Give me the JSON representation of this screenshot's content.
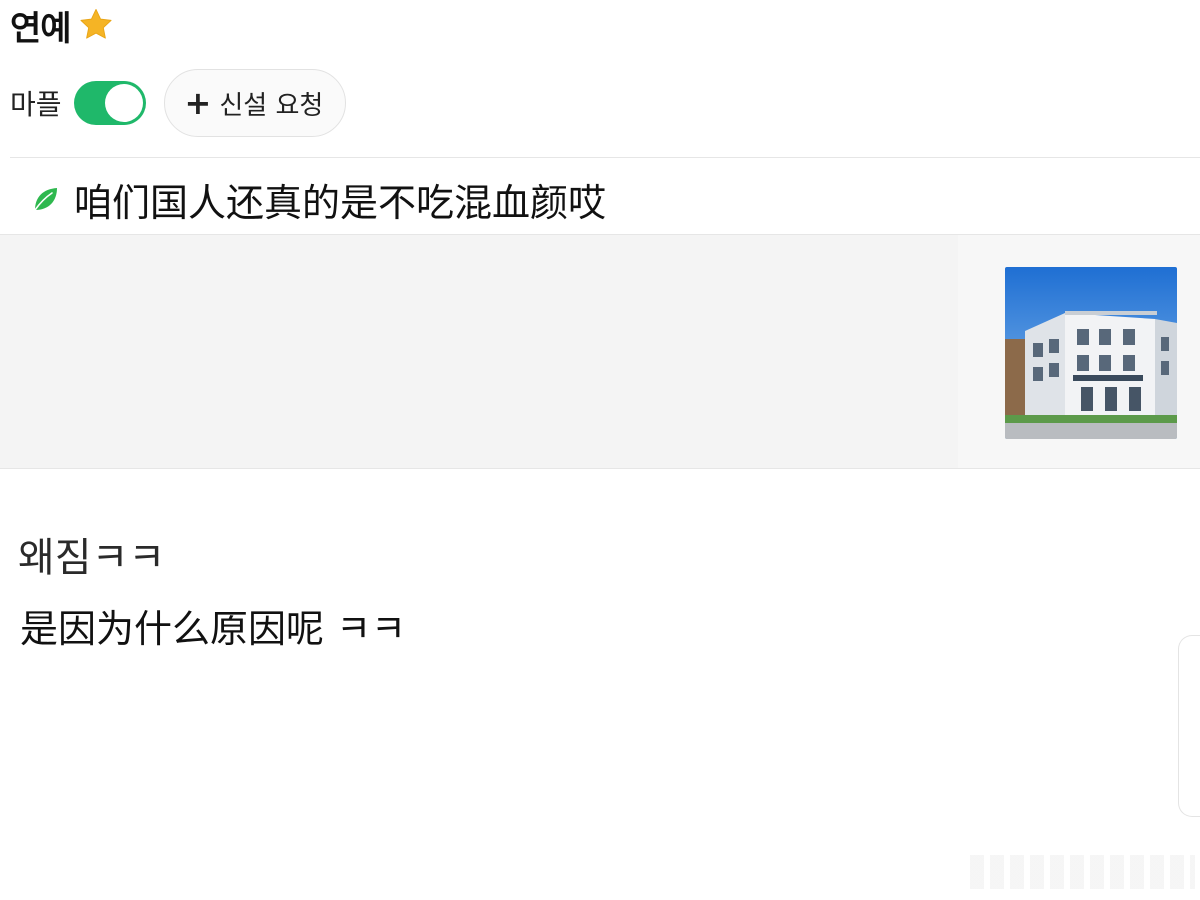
{
  "header": {
    "board_title": "연예",
    "star_icon": "star-icon",
    "star_color": "#f5b425"
  },
  "controls": {
    "toggle_label": "마플",
    "toggle_on": true,
    "toggle_color": "#1fb86a",
    "request_button_label": "신설 요청",
    "request_button_icon": "plus-icon"
  },
  "post_header": {
    "leaf_icon": "leaf-icon",
    "caption": "咱们国人还真的是不吃混血颜哎"
  },
  "post": {
    "thumbnail": "building-photo",
    "title": "왜짐ㅋㅋ",
    "body": "是因为什么原因呢  ㅋㅋ"
  }
}
